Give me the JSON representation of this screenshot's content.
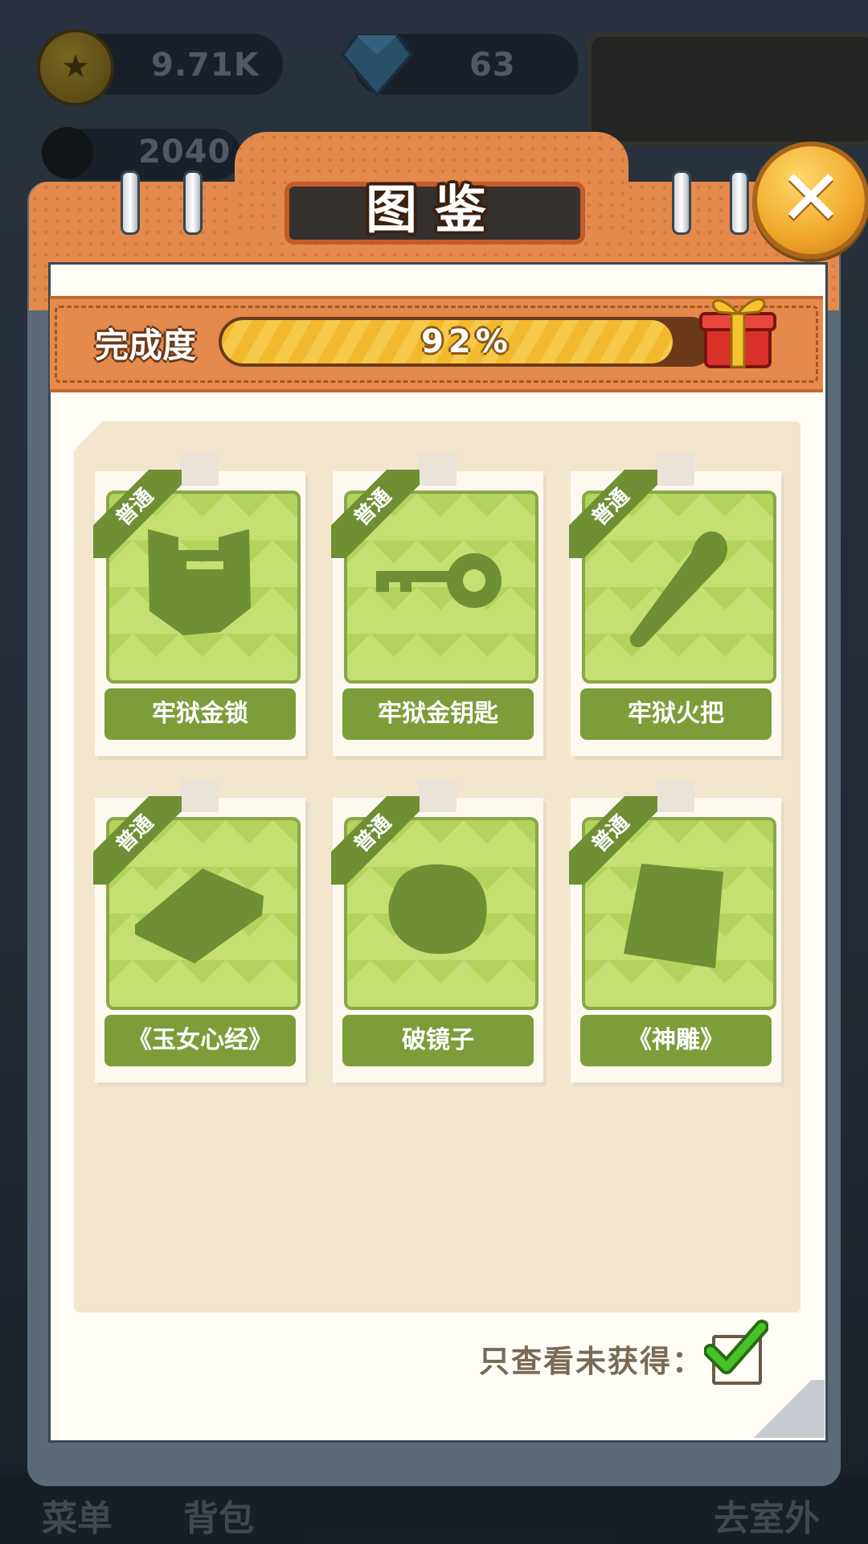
{
  "hud": {
    "coins": "9.71K",
    "gems": "63",
    "score": "2040"
  },
  "bottom_nav": {
    "menu": "菜单",
    "bag": "背包",
    "go_outside": "去室外"
  },
  "dialog": {
    "title": "图鉴",
    "progress_label": "完成度",
    "progress_value": "92%",
    "progress_fraction": 0.92,
    "filter_label": "只查看未获得：",
    "filter_checked": true
  },
  "items": [
    {
      "rarity": "普通",
      "name": "牢狱金锁",
      "icon": "lock-silhouette-icon"
    },
    {
      "rarity": "普通",
      "name": "牢狱金钥匙",
      "icon": "key-silhouette-icon"
    },
    {
      "rarity": "普通",
      "name": "牢狱火把",
      "icon": "torch-silhouette-icon"
    },
    {
      "rarity": "普通",
      "name": "《玉女心经》",
      "icon": "book-silhouette-icon"
    },
    {
      "rarity": "普通",
      "name": "破镜子",
      "icon": "broken-mirror-silhouette-icon"
    },
    {
      "rarity": "普通",
      "name": "《神雕》",
      "icon": "scroll-silhouette-icon"
    }
  ],
  "colors": {
    "accent_orange": "#e48a4c",
    "card_green": "#7c9d3a",
    "silhouette": "#6e8f33"
  }
}
